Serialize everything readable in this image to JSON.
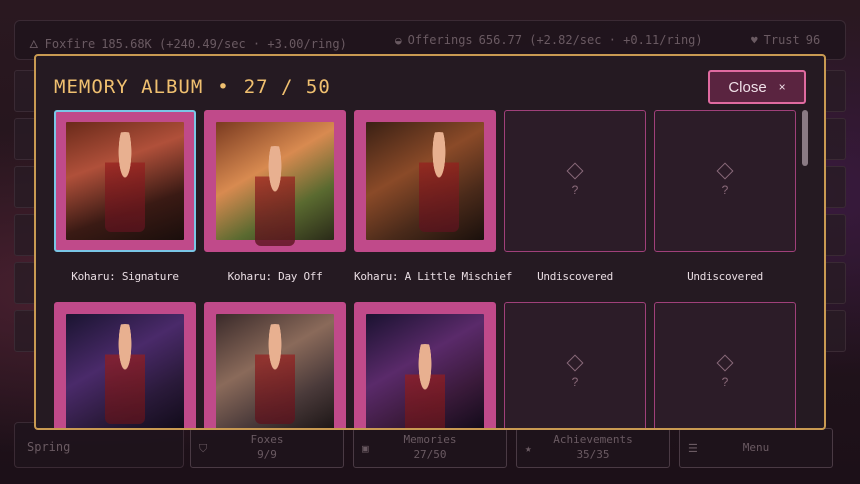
{
  "topbar": {
    "foxfire": {
      "label": "Foxfire",
      "value": "185.68K (+240.49/sec · +3.00/ring)"
    },
    "offerings": {
      "label": "Offerings",
      "value": "656.77 (+2.82/sec · +0.11/ring)"
    },
    "trust": {
      "label": "Trust",
      "value": "96"
    }
  },
  "bottombar": {
    "season": "Spring",
    "foxes": {
      "label": "Foxes",
      "value": "9/9"
    },
    "memories": {
      "label": "Memories",
      "value": "27/50"
    },
    "achievements": {
      "label": "Achievements",
      "value": "35/35"
    },
    "menu": {
      "label": "Menu"
    }
  },
  "modal": {
    "title": "MEMORY ALBUM",
    "separator": "•",
    "count": "27 / 50",
    "close_label": "Close",
    "close_icon": "×"
  },
  "cards": [
    {
      "caption": "Koharu: Signature",
      "state": "selected"
    },
    {
      "caption": "Koharu: Day Off",
      "state": "unlocked"
    },
    {
      "caption": "Koharu: A Little Mischief",
      "state": "unlocked"
    },
    {
      "caption": "Undiscovered",
      "state": "locked",
      "placeholder": "?"
    },
    {
      "caption": "Undiscovered",
      "state": "locked",
      "placeholder": "?"
    },
    {
      "caption": "",
      "state": "unlocked"
    },
    {
      "caption": "",
      "state": "unlocked"
    },
    {
      "caption": "",
      "state": "unlocked"
    },
    {
      "caption": "",
      "state": "locked",
      "placeholder": "?"
    },
    {
      "caption": "",
      "state": "locked",
      "placeholder": "?"
    }
  ],
  "colors": {
    "accent_gold": "#f0c070",
    "frame_pink": "#c04a8a",
    "selected_blue": "#7ac6e6",
    "modal_bg": "#251a22"
  },
  "icons": {
    "foxfire": "flame-icon",
    "offerings": "bowl-icon",
    "trust": "heart-icon",
    "foxes": "fox-icon",
    "memories": "album-icon",
    "achievements": "star-icon",
    "menu": "menu-icon",
    "locked": "diamond-icon"
  }
}
